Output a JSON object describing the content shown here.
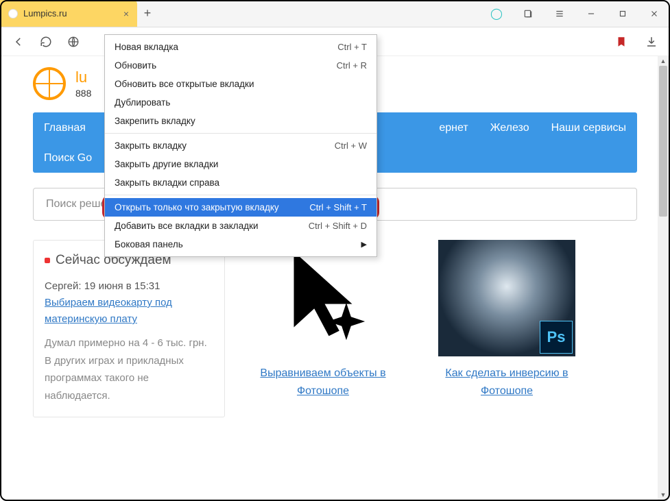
{
  "tab": {
    "title": "Lumpics.ru"
  },
  "site": {
    "title_visible": "lu",
    "phones_visible": "888"
  },
  "nav": {
    "row1": [
      "Главная",
      "",
      "",
      "",
      "",
      "ернет",
      "Железо",
      "Наши сервисы"
    ],
    "row2": [
      "Поиск Go"
    ]
  },
  "search": {
    "placeholder": "Поиск решения..."
  },
  "widget": {
    "heading": "Сейчас обсуждаем",
    "meta": "Сергей: 19 июня в 15:31",
    "link": "Выбираем видеокарту под материнскую плату",
    "body": "Думал примерно на 4 - 6 тыс. грн. В других играх и прикладных программах такого не наблюдается."
  },
  "articles": [
    {
      "title": "Выравниваем объекты в Фотошопе"
    },
    {
      "title": "Как сделать инверсию в Фотошопе",
      "badge": "Ps"
    }
  ],
  "context_menu": {
    "items": [
      {
        "label": "Новая вкладка",
        "shortcut": "Ctrl + T"
      },
      {
        "label": "Обновить",
        "shortcut": "Ctrl + R"
      },
      {
        "label": "Обновить все открытые вкладки"
      },
      {
        "label": "Дублировать"
      },
      {
        "label": "Закрепить вкладку"
      },
      {
        "sep": true
      },
      {
        "label": "Закрыть вкладку",
        "shortcut": "Ctrl + W"
      },
      {
        "label": "Закрыть другие вкладки"
      },
      {
        "label": "Закрыть вкладки справа"
      },
      {
        "sep": true
      },
      {
        "label": "Открыть только что закрытую вкладку",
        "shortcut": "Ctrl + Shift + T",
        "highlight": true
      },
      {
        "label": "Добавить все вкладки в закладки",
        "shortcut": "Ctrl + Shift + D"
      },
      {
        "label": "Боковая панель",
        "submenu": true
      }
    ]
  }
}
